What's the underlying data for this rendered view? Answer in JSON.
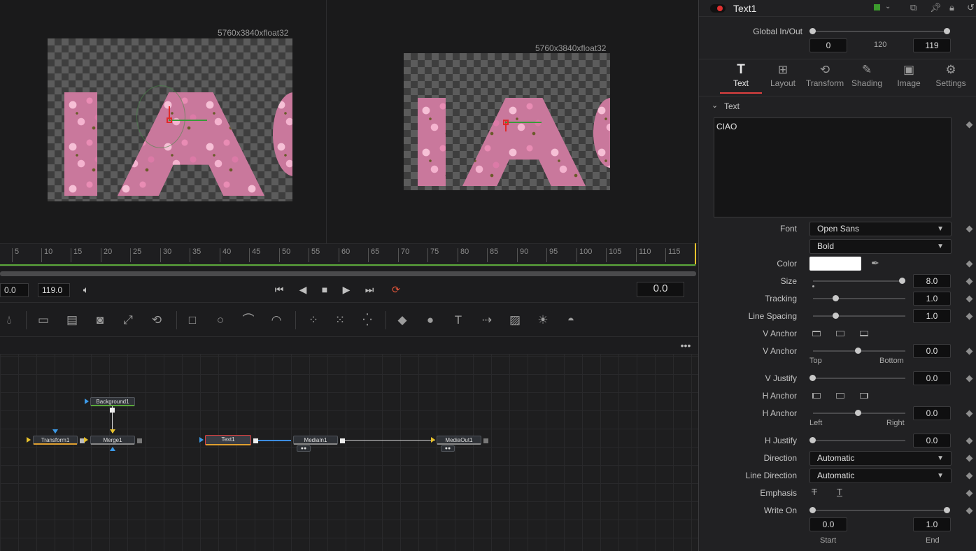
{
  "viewer": {
    "left_resolution": "5760x3840xfloat32",
    "right_resolution": "5760x3840xfloat32"
  },
  "timeline": {
    "ticks": [
      "5",
      "10",
      "15",
      "20",
      "25",
      "30",
      "35",
      "40",
      "45",
      "50",
      "55",
      "60",
      "65",
      "70",
      "75",
      "80",
      "85",
      "90",
      "95",
      "100",
      "105",
      "110",
      "115"
    ],
    "start_value": "0.0",
    "end_value": "119.0",
    "current_time": "0.0"
  },
  "toolbar": {
    "icons": [
      "droplet-icon",
      "paint-icon",
      "merge-icon",
      "mask-icon",
      "resize-icon",
      "transform-icon",
      "rectangle-mask-icon",
      "ellipse-mask-icon",
      "polygon-mask-icon",
      "bspline-mask-icon",
      "particle-emitter-icon",
      "particle-render-icon",
      "particle-pointforce-icon",
      "image-plane-3d-icon",
      "shape-3d-icon",
      "text-3d-icon",
      "merge-3d-icon",
      "camera-3d-icon",
      "spotlight-3d-icon",
      "renderer-3d-icon"
    ]
  },
  "nodes": {
    "background": "Background1",
    "transform": "Transform1",
    "merge": "Merge1",
    "text": "Text1",
    "mediain": "MediaIn1",
    "mediaout": "MediaOut1"
  },
  "inspector": {
    "node_name": "Text1",
    "node_color": "#3c9b2d",
    "global_inout_label": "Global In/Out",
    "global_in": "0",
    "global_mid": "120",
    "global_out": "119",
    "tabs": [
      {
        "label": "Text",
        "icon": "text-tool-icon",
        "glyph": "T"
      },
      {
        "label": "Layout",
        "icon": "layout-icon",
        "glyph": "⊞"
      },
      {
        "label": "Transform",
        "icon": "transform-tab-icon",
        "glyph": "⟲"
      },
      {
        "label": "Shading",
        "icon": "shading-icon",
        "glyph": "✎"
      },
      {
        "label": "Image",
        "icon": "image-icon",
        "glyph": "▣"
      },
      {
        "label": "Settings",
        "icon": "settings-icon",
        "glyph": "⚙"
      }
    ],
    "section_title": "Text",
    "styled_text": "CIAO",
    "font_label": "Font",
    "font_value": "Open Sans",
    "style_value": "Bold",
    "color_label": "Color",
    "size_label": "Size",
    "size_value": "8.0",
    "tracking_label": "Tracking",
    "tracking_value": "1.0",
    "line_spacing_label": "Line Spacing",
    "line_spacing_value": "1.0",
    "v_anchor_label": "V Anchor",
    "v_anchor_value": "0.0",
    "top_label": "Top",
    "bottom_label": "Bottom",
    "v_justify_label": "V Justify",
    "v_justify_value": "0.0",
    "h_anchor_label": "H Anchor",
    "h_anchor_value": "0.0",
    "left_label": "Left",
    "right_label": "Right",
    "h_justify_label": "H Justify",
    "h_justify_value": "0.0",
    "direction_label": "Direction",
    "direction_value": "Automatic",
    "line_direction_label": "Line Direction",
    "line_direction_value": "Automatic",
    "emphasis_label": "Emphasis",
    "write_on_label": "Write On",
    "write_on_start": "0.0",
    "write_on_end": "1.0",
    "start_label": "Start",
    "end_label": "End"
  }
}
